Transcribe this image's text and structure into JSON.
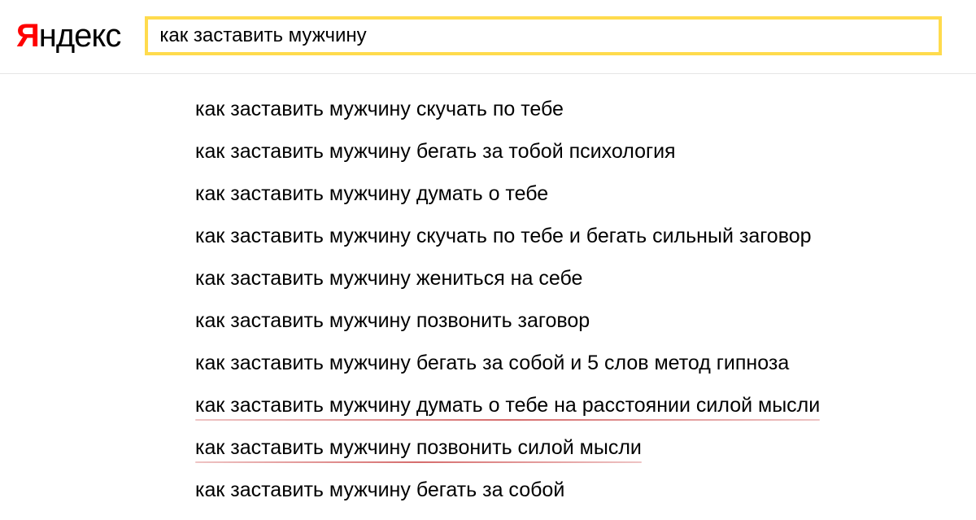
{
  "logo": {
    "first_char": "Я",
    "rest": "ндекс"
  },
  "search": {
    "query": "как заставить мужчину"
  },
  "suggestions": [
    {
      "text": "как заставить мужчину скучать по тебе",
      "underlined": false
    },
    {
      "text": "как заставить мужчину бегать за тобой психология",
      "underlined": false
    },
    {
      "text": "как заставить мужчину думать о тебе",
      "underlined": false
    },
    {
      "text": "как заставить мужчину скучать по тебе и бегать сильный заговор",
      "underlined": false
    },
    {
      "text": "как заставить мужчину жениться на себе",
      "underlined": false
    },
    {
      "text": "как заставить мужчину позвонить заговор",
      "underlined": false
    },
    {
      "text": "как заставить мужчину бегать за собой и 5 слов метод гипноза",
      "underlined": false
    },
    {
      "text": "как заставить мужчину думать о тебе на расстоянии силой мысли",
      "underlined": true
    },
    {
      "text": "как заставить мужчину позвонить силой мысли",
      "underlined": true
    },
    {
      "text": "как заставить мужчину бегать за собой",
      "underlined": false
    }
  ]
}
